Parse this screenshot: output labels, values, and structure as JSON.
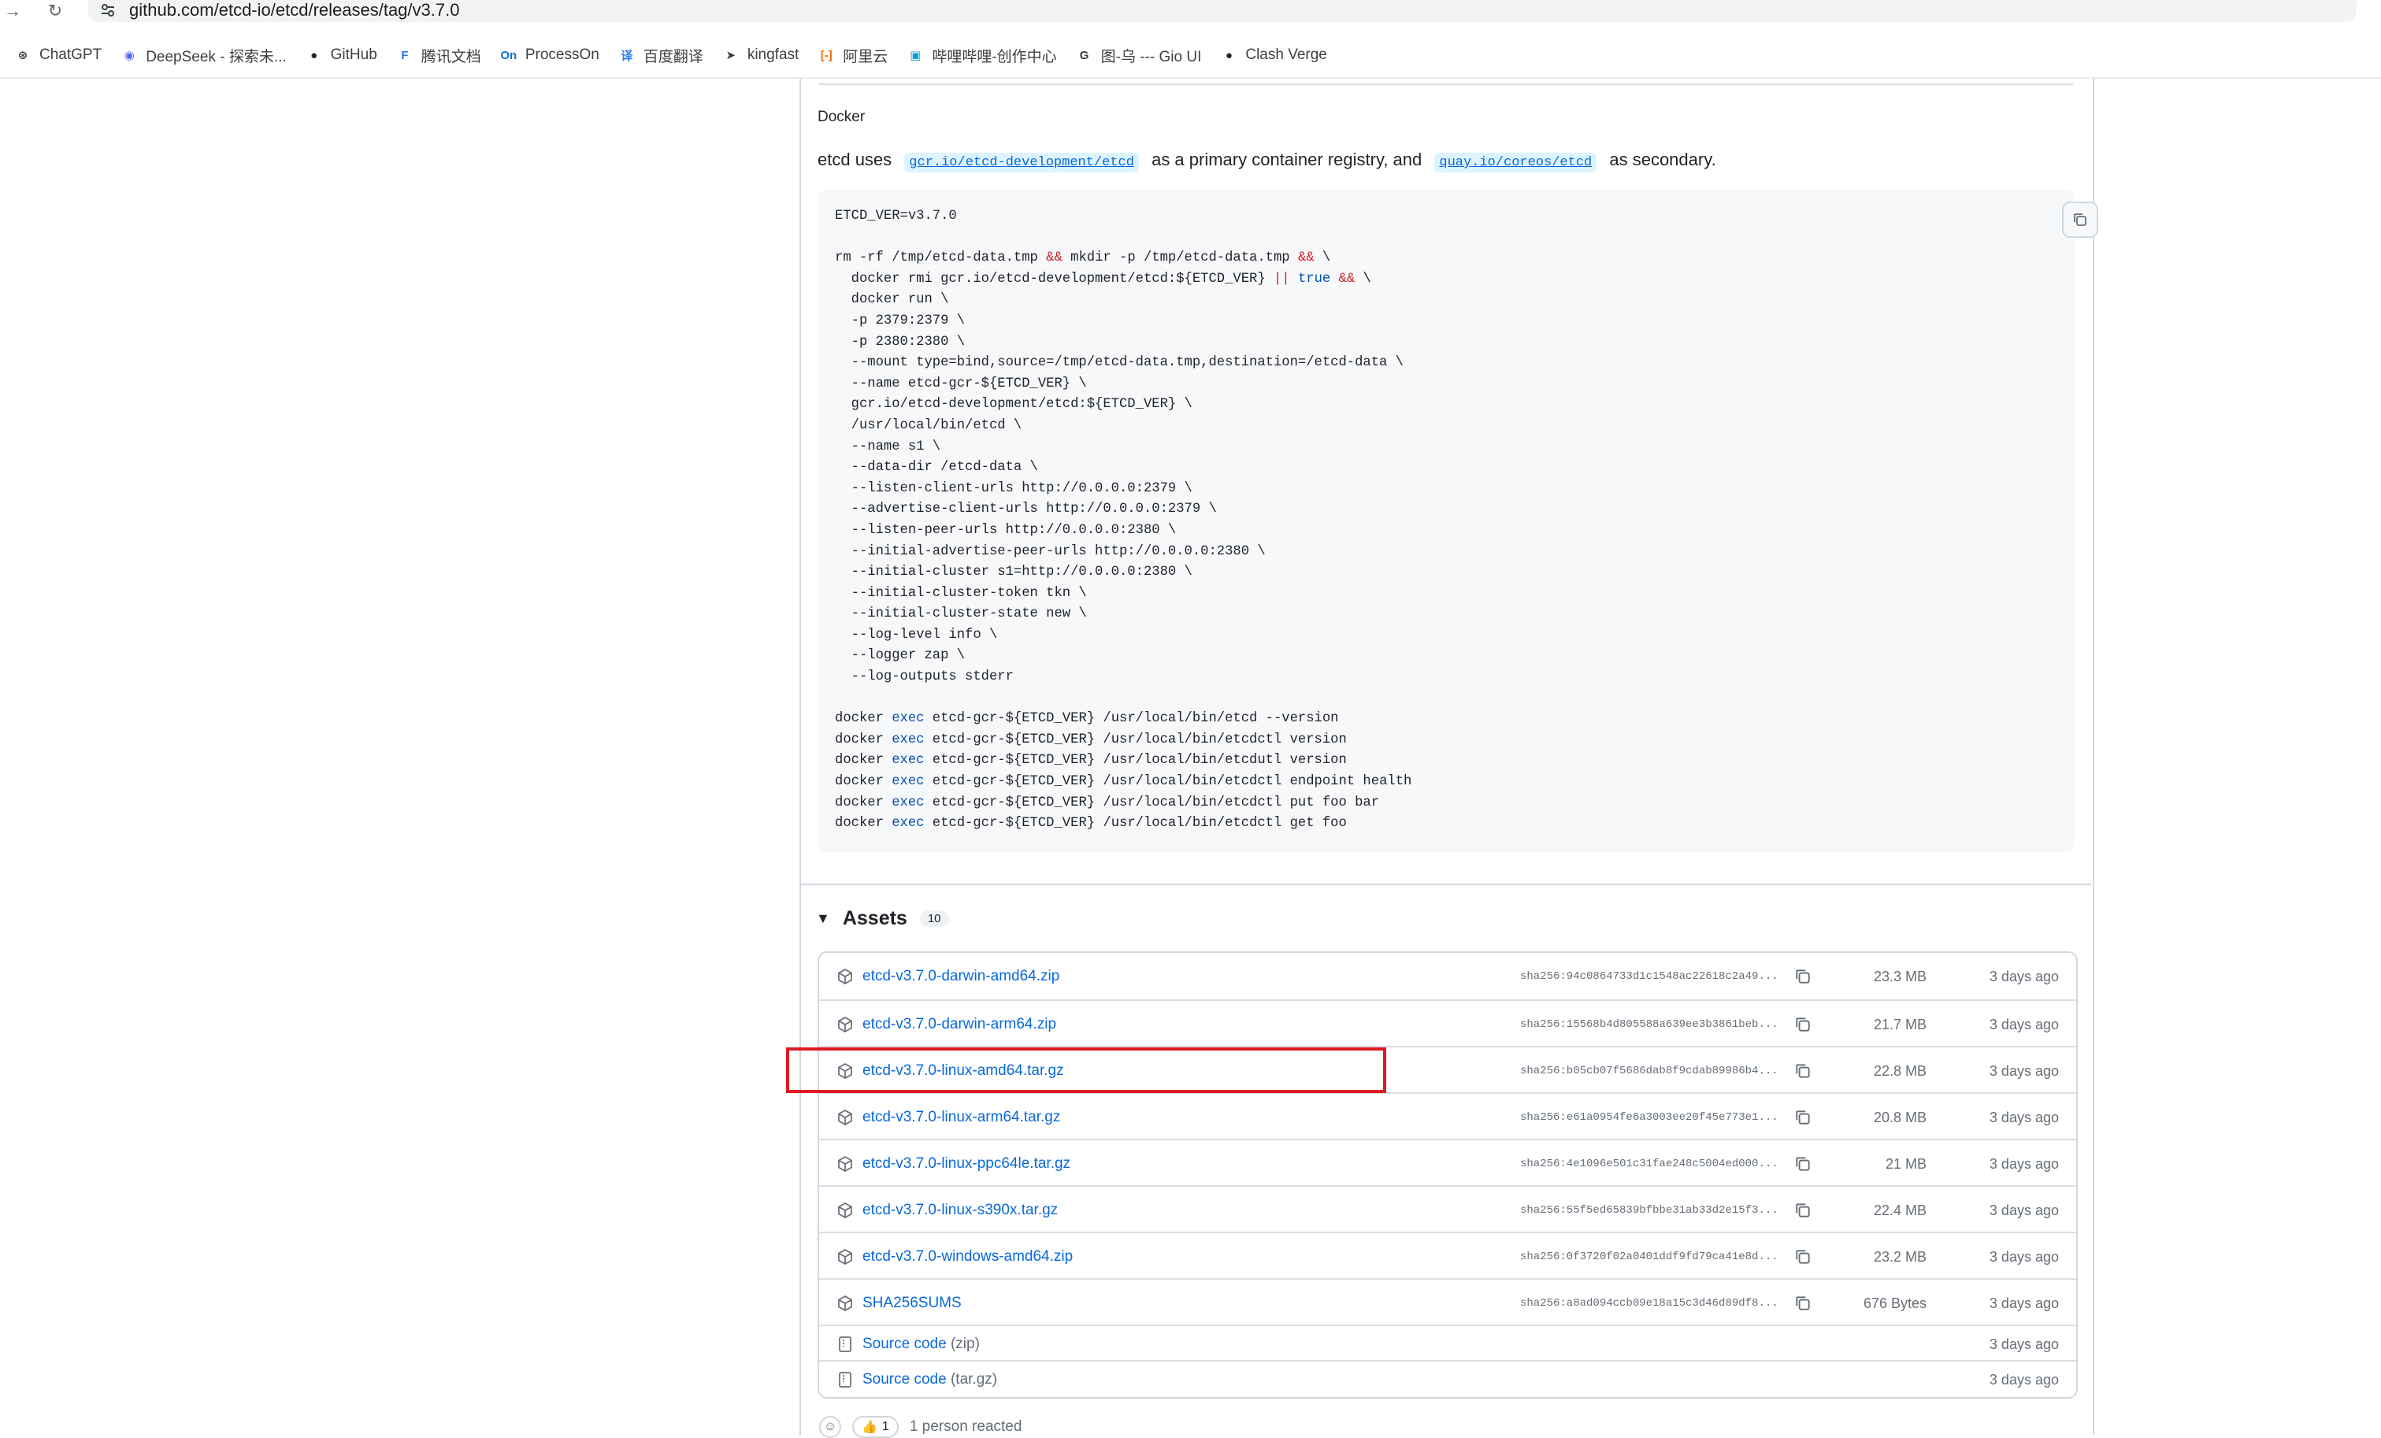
{
  "browser": {
    "url": "github.com/etcd-io/etcd/releases/tag/v3.7.0",
    "bookmarks": [
      {
        "label": "ChatGPT",
        "icon": "chatgpt-icon",
        "color": "#3c4043",
        "glyph": "⊛"
      },
      {
        "label": "DeepSeek - 探索未...",
        "icon": "deepseek-icon",
        "color": "#4d6bfe",
        "glyph": "◉"
      },
      {
        "label": "GitHub",
        "icon": "github-icon",
        "color": "#1f2328",
        "glyph": "●"
      },
      {
        "label": "腾讯文档",
        "icon": "tencent-docs-icon",
        "color": "#1e6fff",
        "glyph": "F"
      },
      {
        "label": "ProcessOn",
        "icon": "processon-icon",
        "color": "#0f6ed1",
        "glyph": "On"
      },
      {
        "label": "百度翻译",
        "icon": "baidu-translate-icon",
        "color": "#2b7bf6",
        "glyph": "译"
      },
      {
        "label": "kingfast",
        "icon": "cursor-icon",
        "color": "#3c4043",
        "glyph": "➤"
      },
      {
        "label": "阿里云",
        "icon": "aliyun-icon",
        "color": "#ff6a00",
        "glyph": "[-]"
      },
      {
        "label": "哔哩哔哩-创作中心",
        "icon": "bilibili-icon",
        "color": "#00a1d6",
        "glyph": "▣"
      },
      {
        "label": "图-乌 --- Gio UI",
        "icon": "gio-icon",
        "color": "#3c4043",
        "glyph": "G"
      },
      {
        "label": "Clash Verge",
        "icon": "github-icon",
        "color": "#1f2328",
        "glyph": "●"
      }
    ]
  },
  "docker": {
    "heading": "Docker",
    "para_before": "etcd uses",
    "registry_primary": "gcr.io/etcd-development/etcd",
    "para_middle": "as a primary container registry, and",
    "registry_secondary": "quay.io/coreos/etcd",
    "para_after": "as secondary."
  },
  "code_lines": [
    "ETCD_VER=v3.7.0",
    "",
    "rm -rf /tmp/etcd-data.tmp && mkdir -p /tmp/etcd-data.tmp && \\",
    "  docker rmi gcr.io/etcd-development/etcd:${ETCD_VER} || true && \\",
    "  docker run \\",
    "  -p 2379:2379 \\",
    "  -p 2380:2380 \\",
    "  --mount type=bind,source=/tmp/etcd-data.tmp,destination=/etcd-data \\",
    "  --name etcd-gcr-${ETCD_VER} \\",
    "  gcr.io/etcd-development/etcd:${ETCD_VER} \\",
    "  /usr/local/bin/etcd \\",
    "  --name s1 \\",
    "  --data-dir /etcd-data \\",
    "  --listen-client-urls http://0.0.0.0:2379 \\",
    "  --advertise-client-urls http://0.0.0.0:2379 \\",
    "  --listen-peer-urls http://0.0.0.0:2380 \\",
    "  --initial-advertise-peer-urls http://0.0.0.0:2380 \\",
    "  --initial-cluster s1=http://0.0.0.0:2380 \\",
    "  --initial-cluster-token tkn \\",
    "  --initial-cluster-state new \\",
    "  --log-level info \\",
    "  --logger zap \\",
    "  --log-outputs stderr",
    "",
    "docker exec etcd-gcr-${ETCD_VER} /usr/local/bin/etcd --version",
    "docker exec etcd-gcr-${ETCD_VER} /usr/local/bin/etcdctl version",
    "docker exec etcd-gcr-${ETCD_VER} /usr/local/bin/etcdutl version",
    "docker exec etcd-gcr-${ETCD_VER} /usr/local/bin/etcdctl endpoint health",
    "docker exec etcd-gcr-${ETCD_VER} /usr/local/bin/etcdctl put foo bar",
    "docker exec etcd-gcr-${ETCD_VER} /usr/local/bin/etcdctl get foo"
  ],
  "assets": {
    "title": "Assets",
    "count": "10",
    "items": [
      {
        "name": "etcd-v3.7.0-darwin-amd64.zip",
        "sha": "sha256:94c0864733d1c1548ac22618c2a49...",
        "size": "23.3 MB",
        "date": "3 days ago"
      },
      {
        "name": "etcd-v3.7.0-darwin-arm64.zip",
        "sha": "sha256:15568b4d805588a639ee3b3861beb...",
        "size": "21.7 MB",
        "date": "3 days ago"
      },
      {
        "name": "etcd-v3.7.0-linux-amd64.tar.gz",
        "sha": "sha256:b05cb07f5686dab8f9cdab89986b4...",
        "size": "22.8 MB",
        "date": "3 days ago"
      },
      {
        "name": "etcd-v3.7.0-linux-arm64.tar.gz",
        "sha": "sha256:e61a0954fe6a3003ee20f45e773e1...",
        "size": "20.8 MB",
        "date": "3 days ago"
      },
      {
        "name": "etcd-v3.7.0-linux-ppc64le.tar.gz",
        "sha": "sha256:4e1096e501c31fae248c5004ed000...",
        "size": "21 MB",
        "date": "3 days ago"
      },
      {
        "name": "etcd-v3.7.0-linux-s390x.tar.gz",
        "sha": "sha256:55f5ed65839bfbbe31ab33d2e15f3...",
        "size": "22.4 MB",
        "date": "3 days ago"
      },
      {
        "name": "etcd-v3.7.0-windows-amd64.zip",
        "sha": "sha256:0f3720f02a0401ddf9fd79ca41e8d...",
        "size": "23.2 MB",
        "date": "3 days ago"
      },
      {
        "name": "SHA256SUMS",
        "sha": "sha256:a8ad094ccb09e18a15c3d46d89df8...",
        "size": "676 Bytes",
        "date": "3 days ago"
      }
    ],
    "source": [
      {
        "label": "Source code",
        "kind": "(zip)",
        "date": "3 days ago"
      },
      {
        "label": "Source code",
        "kind": "(tar.gz)",
        "date": "3 days ago"
      }
    ]
  },
  "reactions": {
    "emoji": "👍",
    "count": "1",
    "summary": "1 person reacted"
  },
  "colors": {
    "link": "#0969da",
    "muted": "#656d76",
    "highlight": "#e01a22",
    "code_keyword_red": "#cf222e",
    "code_keyword_blue": "#0550ae"
  }
}
